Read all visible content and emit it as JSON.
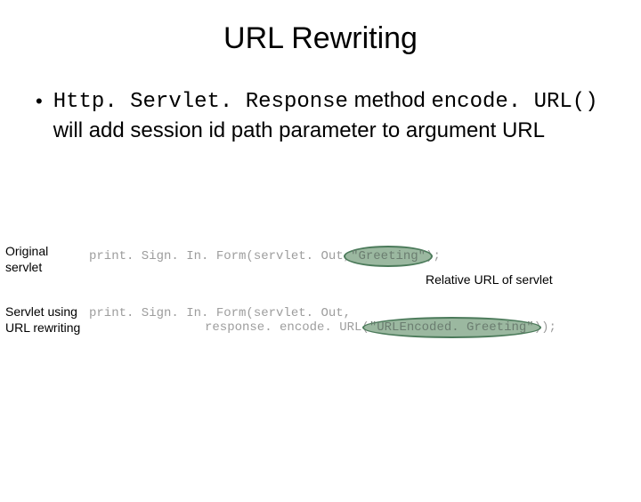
{
  "title": "URL Rewriting",
  "bullet": {
    "dot": "•",
    "code1": "Http. Servlet. Response",
    "text1": " method ",
    "code2": "encode. URL()",
    "text2": " will add session id path parameter to argument URL"
  },
  "labels": {
    "original": "Original servlet",
    "servlet": "Servlet using URL rewriting",
    "relative": "Relative URL of servlet"
  },
  "code": {
    "line1_prefix": "print. Sign. In. Form(servlet. Out, ",
    "line1_highlight": "\"Greeting\"",
    "line1_suffix": ");",
    "line2a": "print. Sign. In. Form(servlet. Out,",
    "line2b_prefix": "response. encode. URL(",
    "line2b_highlight": "\"URLEncoded. Greeting\"",
    "line2b_suffix": "));"
  }
}
